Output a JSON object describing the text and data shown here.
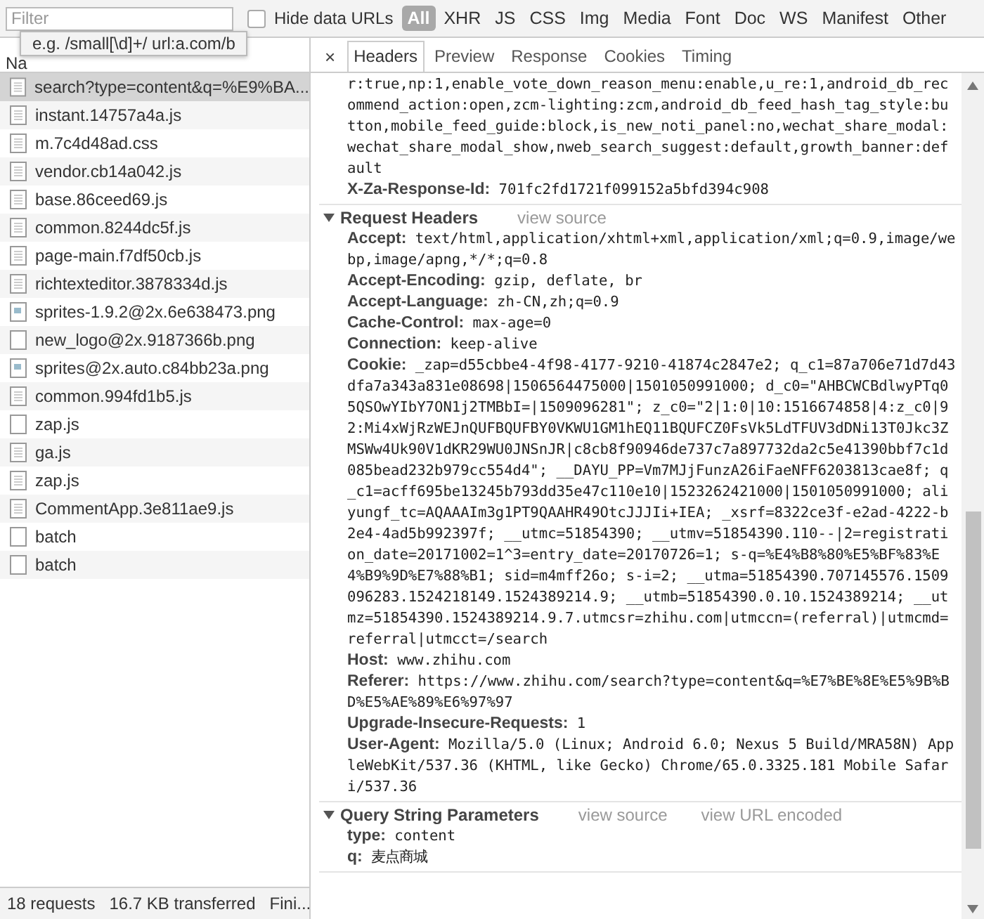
{
  "toolbar": {
    "filter": {
      "placeholder": "Filter"
    },
    "hide_data_urls": {
      "label": "Hide data URLs",
      "checked": false
    },
    "types": [
      {
        "label": "All",
        "selected": true
      },
      {
        "label": "XHR",
        "selected": false
      },
      {
        "label": "JS",
        "selected": false
      },
      {
        "label": "CSS",
        "selected": false
      },
      {
        "label": "Img",
        "selected": false
      },
      {
        "label": "Media",
        "selected": false
      },
      {
        "label": "Font",
        "selected": false
      },
      {
        "label": "Doc",
        "selected": false
      },
      {
        "label": "WS",
        "selected": false
      },
      {
        "label": "Manifest",
        "selected": false
      },
      {
        "label": "Other",
        "selected": false
      }
    ]
  },
  "tooltip": "e.g. /small[\\d]+/ url:a.com/b",
  "name_column_header": "Na",
  "requests": [
    {
      "name": "search?type=content&q=%E9%BA...",
      "kind": "script",
      "selected": true
    },
    {
      "name": "instant.14757a4a.js",
      "kind": "script",
      "selected": false
    },
    {
      "name": "m.7c4d48ad.css",
      "kind": "script",
      "selected": false
    },
    {
      "name": "vendor.cb14a042.js",
      "kind": "script",
      "selected": false
    },
    {
      "name": "base.86ceed69.js",
      "kind": "script",
      "selected": false
    },
    {
      "name": "common.8244dc5f.js",
      "kind": "script",
      "selected": false
    },
    {
      "name": "page-main.f7df50cb.js",
      "kind": "script",
      "selected": false
    },
    {
      "name": "richtexteditor.3878334d.js",
      "kind": "script",
      "selected": false
    },
    {
      "name": "sprites-1.9.2@2x.6e638473.png",
      "kind": "image",
      "selected": false
    },
    {
      "name": "new_logo@2x.9187366b.png",
      "kind": "other",
      "selected": false
    },
    {
      "name": "sprites@2x.auto.c84bb23a.png",
      "kind": "image",
      "selected": false
    },
    {
      "name": "common.994fd1b5.js",
      "kind": "script",
      "selected": false
    },
    {
      "name": "zap.js",
      "kind": "other",
      "selected": false
    },
    {
      "name": "ga.js",
      "kind": "script",
      "selected": false
    },
    {
      "name": "zap.js",
      "kind": "script",
      "selected": false
    },
    {
      "name": "CommentApp.3e811ae9.js",
      "kind": "script",
      "selected": false
    },
    {
      "name": "batch",
      "kind": "other",
      "selected": false
    },
    {
      "name": "batch",
      "kind": "other",
      "selected": false
    }
  ],
  "status_bar": [
    "18 requests",
    "16.7 KB transferred",
    "Fini..."
  ],
  "close_button": "×",
  "detail_tabs": [
    {
      "label": "Headers",
      "selected": true
    },
    {
      "label": "Preview",
      "selected": false
    },
    {
      "label": "Response",
      "selected": false
    },
    {
      "label": "Cookies",
      "selected": false
    },
    {
      "label": "Timing",
      "selected": false
    }
  ],
  "response_headers_tail": {
    "value": "r:true,np:1,enable_vote_down_reason_menu:enable,u_re:1,android_db_recommend_action:open,zcm-lighting:zcm,android_db_feed_hash_tag_style:button,mobile_feed_guide:block,is_new_noti_panel:no,wechat_share_modal:wechat_share_modal_show,nweb_search_suggest:default,growth_banner:default",
    "headers": [
      {
        "key": "X-Za-Response-Id:",
        "value": "701fc2fd1721f099152a5bfd394c908"
      }
    ]
  },
  "sections": [
    {
      "title": "Request Headers",
      "expanded": true,
      "links": [
        "view source"
      ],
      "headers": [
        {
          "key": "Accept:",
          "value": "text/html,application/xhtml+xml,application/xml;q=0.9,image/webp,image/apng,*/*;q=0.8"
        },
        {
          "key": "Accept-Encoding:",
          "value": "gzip, deflate, br"
        },
        {
          "key": "Accept-Language:",
          "value": "zh-CN,zh;q=0.9"
        },
        {
          "key": "Cache-Control:",
          "value": "max-age=0"
        },
        {
          "key": "Connection:",
          "value": "keep-alive"
        },
        {
          "key": "Cookie:",
          "value": "_zap=d55cbbe4-4f98-4177-9210-41874c2847e2; q_c1=87a706e71d7d43dfa7a343a831e08698|1506564475000|1501050991000; d_c0=\"AHBCWCBdlwyPTq05QSOwYIbY7ON1j2TMBbI=|1509096281\"; z_c0=\"2|1:0|10:1516674858|4:z_c0|92:Mi4xWjRzWEJnQUFBQUFBY0VKWU1GM1hEQ11BQUFCZ0FsVk5LdTFUV3dDNi13T0Jkc3ZMSWw4Uk90V1dKR29WU0JNSnJR|c8cb8f90946de737c7a897732da2c5e41390bbf7c1d085bead232b979cc554d4\"; __DAYU_PP=Vm7MJjFunzA26iFaeNFF6203813cae8f; q_c1=acff695be13245b793dd35e47c110e10|1523262421000|1501050991000; aliyungf_tc=AQAAAIm3g1PT9QAAHR49OtcJJJIi+IEA; _xsrf=8322ce3f-e2ad-4222-b2e4-4ad5b992397f; __utmc=51854390; __utmv=51854390.110--|2=registration_date=20171002=1^3=entry_date=20170726=1; s-q=%E4%B8%80%E5%BF%83%E4%B9%9D%E7%88%B1; sid=m4mff26o; s-i=2; __utma=51854390.707145576.1509096283.1524218149.1524389214.9; __utmb=51854390.0.10.1524389214; __utmz=51854390.1524389214.9.7.utmcsr=zhihu.com|utmccn=(referral)|utmcmd=referral|utmcct=/search"
        },
        {
          "key": "Host:",
          "value": "www.zhihu.com"
        },
        {
          "key": "Referer:",
          "value": "https://www.zhihu.com/search?type=content&q=%E7%BE%8E%E5%9B%BD%E5%AE%89%E6%97%97"
        },
        {
          "key": "Upgrade-Insecure-Requests:",
          "value": "1"
        },
        {
          "key": "User-Agent:",
          "value": "Mozilla/5.0 (Linux; Android 6.0; Nexus 5 Build/MRA58N) AppleWebKit/537.36 (KHTML, like Gecko) Chrome/65.0.3325.181 Mobile Safari/537.36"
        }
      ]
    },
    {
      "title": "Query String Parameters",
      "expanded": true,
      "links": [
        "view source",
        "view URL encoded"
      ],
      "headers": [
        {
          "key": "type:",
          "value": "content"
        },
        {
          "key": "q:",
          "value": "麦点商城"
        }
      ]
    }
  ]
}
